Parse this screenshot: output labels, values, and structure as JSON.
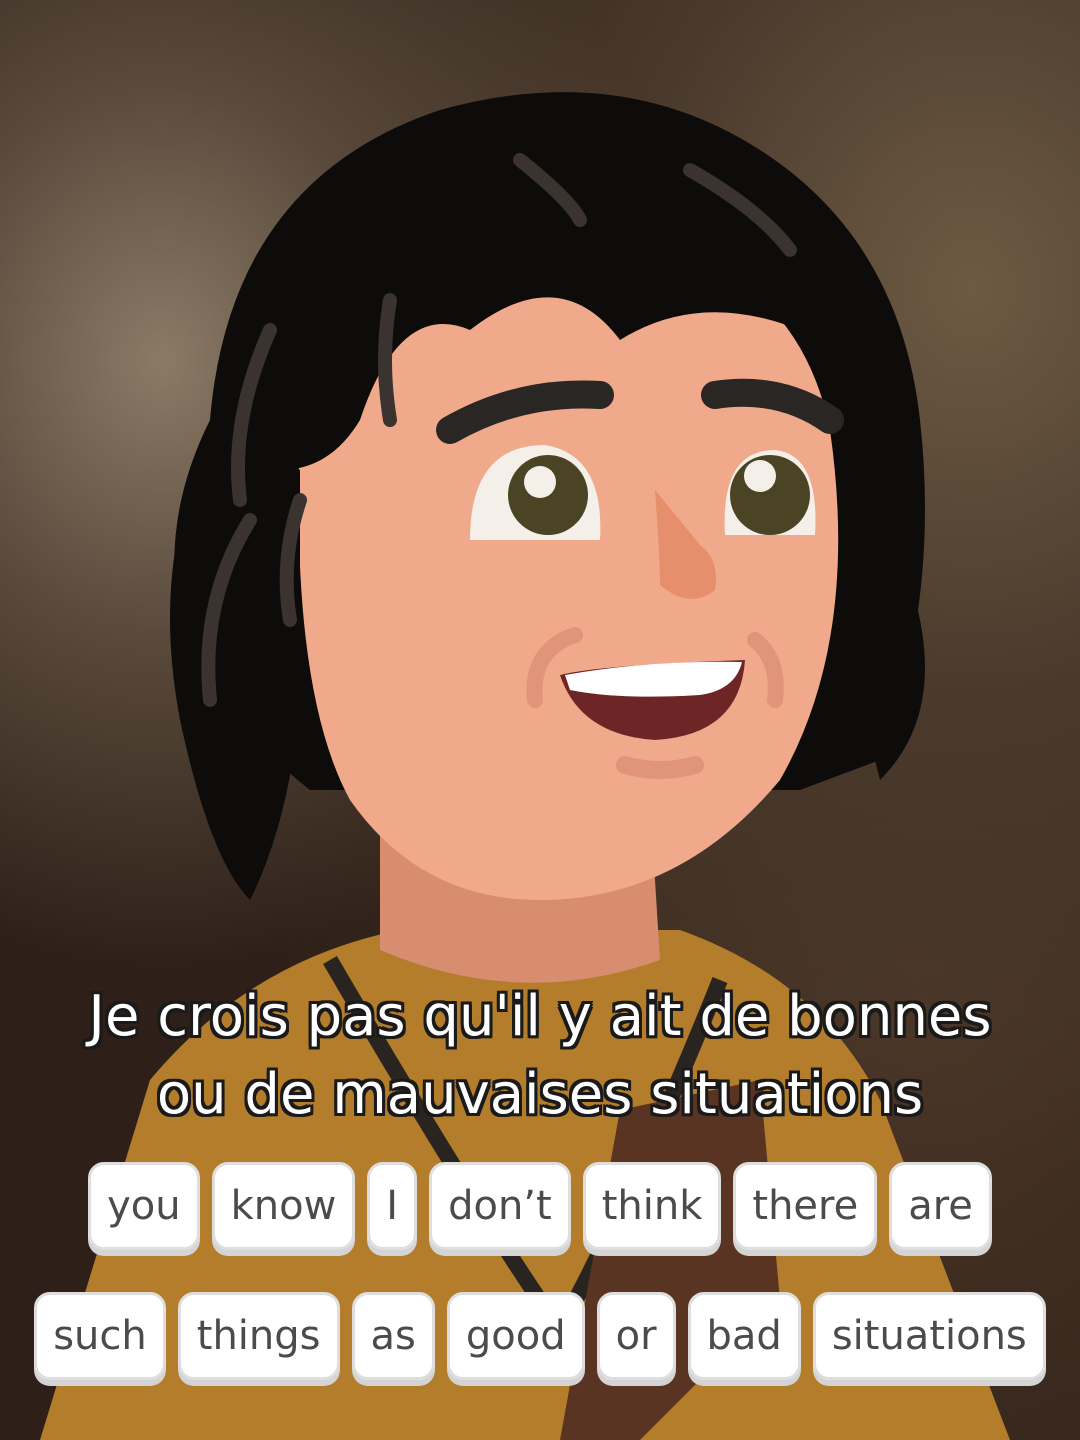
{
  "subtitle": {
    "line1": "Je crois pas qu'il y ait de bonnes",
    "line2": "ou de mauvaises situations"
  },
  "word_bank": {
    "row1": [
      "you",
      "know",
      "I",
      "don’t",
      "think",
      "there",
      "are"
    ],
    "row2": [
      "such",
      "things",
      "as",
      "good",
      "or",
      "bad",
      "situations"
    ]
  },
  "colors": {
    "skin": "#f0a98a",
    "hair": "#0e0c0b",
    "shirt": "#b37d2b",
    "mouth": "#6e2525",
    "eye_iris": "#4a4424"
  }
}
